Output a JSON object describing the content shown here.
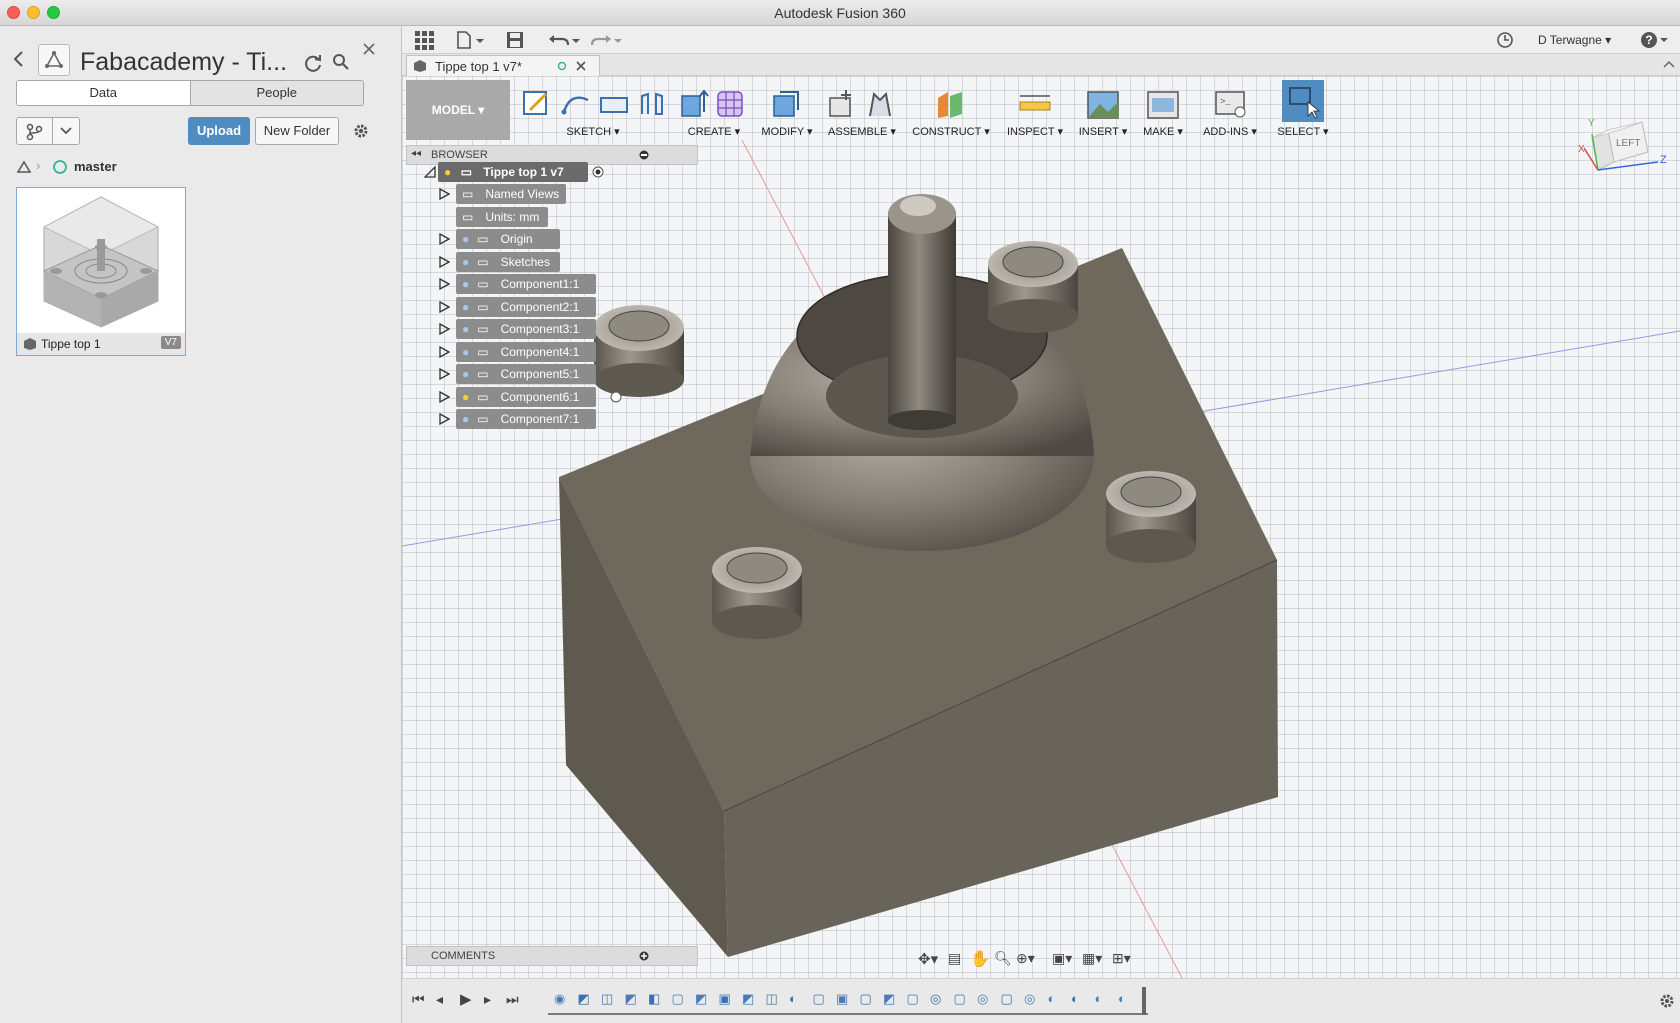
{
  "window": {
    "title": "Autodesk Fusion 360"
  },
  "data_panel": {
    "project_title": "Fabacademy - Ti...",
    "tabs": [
      {
        "label": "Data"
      },
      {
        "label": "People"
      }
    ],
    "upload_label": "Upload",
    "new_folder_label": "New Folder",
    "branch": "master",
    "design": {
      "name": "Tippe top 1",
      "version": "V7"
    }
  },
  "toolbar": {
    "user": "D Terwagne"
  },
  "document_tab": {
    "label": "Tippe top 1 v7*"
  },
  "ribbon": {
    "workspace": "MODEL",
    "groups": [
      "SKETCH",
      "CREATE",
      "MODIFY",
      "ASSEMBLE",
      "CONSTRUCT",
      "INSPECT",
      "INSERT",
      "MAKE",
      "ADD-INS",
      "SELECT"
    ]
  },
  "browser": {
    "title": "BROWSER",
    "root": "Tippe top 1 v7",
    "items": [
      {
        "label": "Named Views"
      },
      {
        "label": "Units: mm"
      },
      {
        "label": "Origin"
      },
      {
        "label": "Sketches"
      },
      {
        "label": "Component1:1"
      },
      {
        "label": "Component2:1"
      },
      {
        "label": "Component3:1"
      },
      {
        "label": "Component4:1"
      },
      {
        "label": "Component5:1"
      },
      {
        "label": "Component6:1"
      },
      {
        "label": "Component7:1"
      }
    ]
  },
  "comments": {
    "title": "COMMENTS"
  },
  "viewcube": {
    "face": "LEFT",
    "axis_z": "Z",
    "axis_x": "X",
    "axis_y": "Y"
  },
  "colors": {
    "accent": "#4e8cc2",
    "model": "#6b6559",
    "grid": "#f4f5f6"
  }
}
